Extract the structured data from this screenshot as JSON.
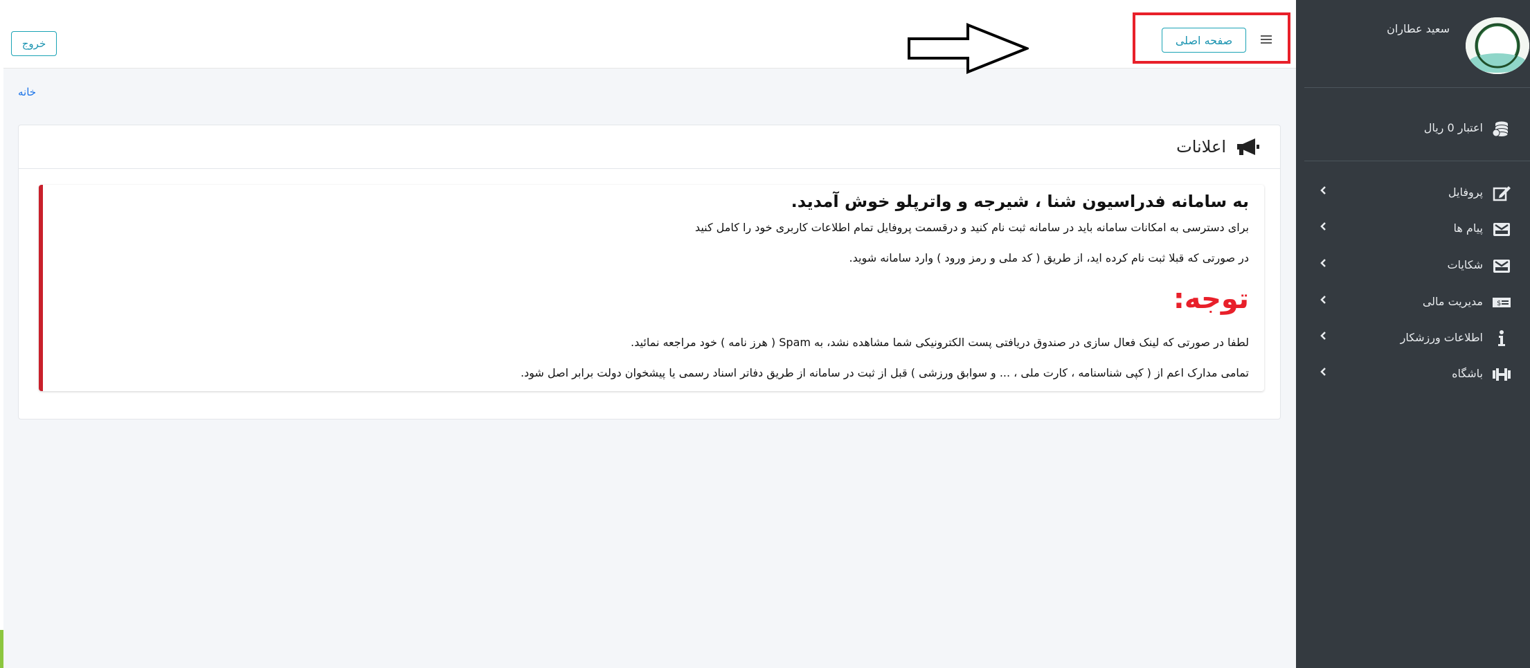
{
  "header": {
    "logout_label": "خروج",
    "home_label": "صفحه اصلی"
  },
  "breadcrumb": {
    "home": "خانه"
  },
  "announcements": {
    "title": "اعلانات",
    "welcome": "به سامانه فدراسیون شنا ، شیرجه و واترپلو خوش آمدید.",
    "line1": "برای دسترسی به امکانات سامانه باید در سامانه ثبت نام کنید و درقسمت پروفایل تمام اطلاعات کاربری خود را کامل کنید",
    "line2": "در صورتی که قبلا ثبت نام کرده اید، از طریق ( کد ملی و رمز ورود ) وارد سامانه شوید.",
    "attention": "توجه:",
    "line3": "لطفا در صورتی که لینک فعال سازی در صندوق دریافتی پست الکترونیکی شما مشاهده نشد، به Spam ( هرز نامه ) خود مراجعه نمائید.",
    "line4": "تمامی مدارک اعم از ( کپی شناسنامه ، کارت ملی ، ... و سوابق ورزشی ) قبل از ثبت در سامانه  از طریق دفاتر اسناد رسمی یا پیشخوان دولت برابر اصل شود."
  },
  "sidebar": {
    "username": "سعید عطاران",
    "credit": "اعتبار 0 ریال",
    "items": [
      {
        "label": "پروفایل",
        "icon": "edit-icon"
      },
      {
        "label": "پیام ها",
        "icon": "inbox-icon"
      },
      {
        "label": "شکایات",
        "icon": "inbox-icon"
      },
      {
        "label": "مدیریت مالی",
        "icon": "money-bill-icon"
      },
      {
        "label": "اطلاعات ورزشکار",
        "icon": "info-icon"
      },
      {
        "label": "باشگاه",
        "icon": "dumbbell-icon"
      }
    ]
  },
  "colors": {
    "sidebar_bg": "#343a40",
    "accent": "#1aa3b5",
    "highlight_red": "#e8202a",
    "callout_border": "#c9202b"
  }
}
